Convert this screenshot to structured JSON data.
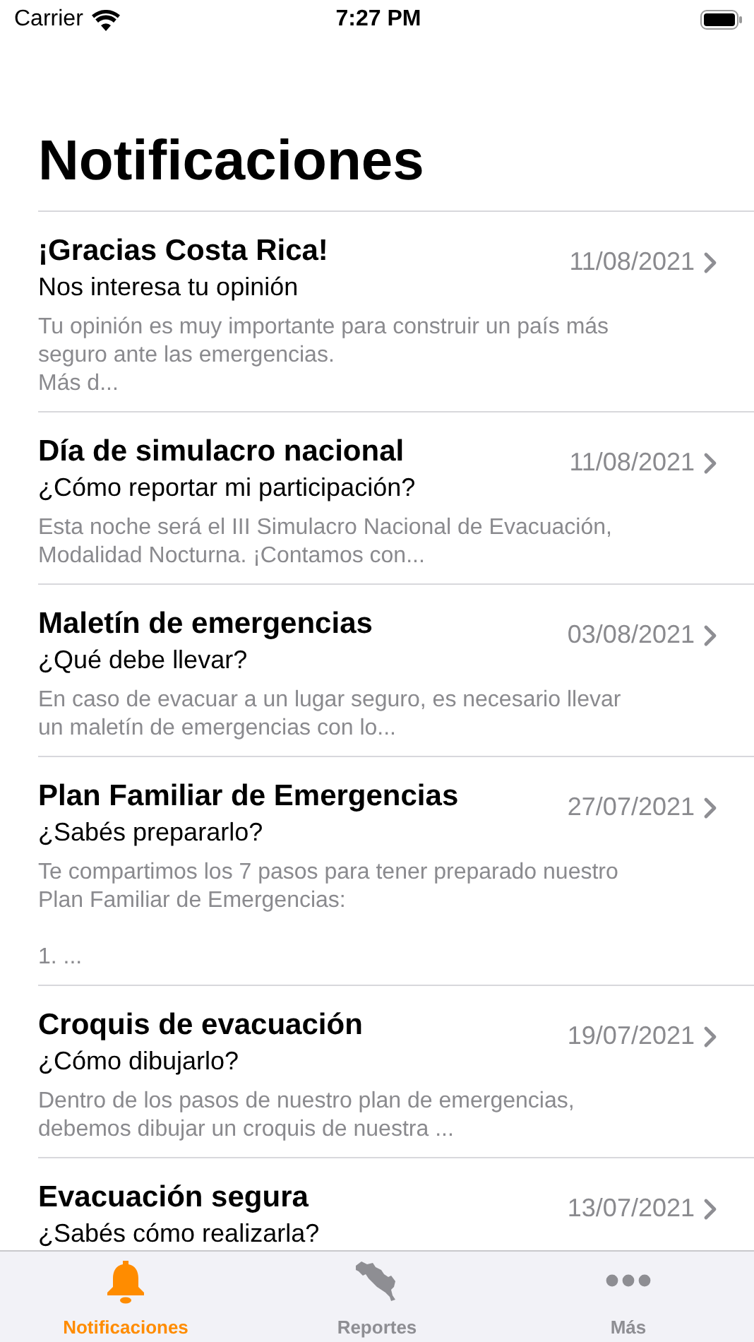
{
  "status_bar": {
    "carrier": "Carrier",
    "time": "7:27 PM"
  },
  "title": "Notificaciones",
  "notifications": [
    {
      "title": "¡Gracias Costa Rica!",
      "subtitle": "Nos interesa tu opinión",
      "date": "11/08/2021",
      "preview": "Tu opinión es muy importante para construir un país más\nseguro ante las emergencias.\nMás d..."
    },
    {
      "title": "Día de simulacro nacional",
      "subtitle": "¿Cómo reportar mi participación?",
      "date": "11/08/2021",
      "preview": "Esta noche será el III Simulacro Nacional de Evacuación,\nModalidad Nocturna. ¡Contamos con..."
    },
    {
      "title": "Maletín de emergencias",
      "subtitle": "¿Qué debe llevar?",
      "date": "03/08/2021",
      "preview": "En caso de evacuar a un lugar seguro, es necesario llevar\nun maletín de emergencias con lo..."
    },
    {
      "title": "Plan Familiar de Emergencias",
      "subtitle": "¿Sabés prepararlo?",
      "date": "27/07/2021",
      "preview": "Te compartimos los 7 pasos para tener preparado nuestro\nPlan Familiar de Emergencias:\n\n1. ..."
    },
    {
      "title": "Croquis de evacuación",
      "subtitle": "¿Cómo dibujarlo?",
      "date": "19/07/2021",
      "preview": "Dentro de los pasos de nuestro plan de emergencias,\ndebemos dibujar un croquis de nuestra ..."
    },
    {
      "title": "Evacuación segura",
      "subtitle": "¿Sabés cómo realizarla?",
      "date": "13/07/2021"
    }
  ],
  "tabs": [
    {
      "kind": "bell",
      "label": "Notificaciones",
      "selected": true
    },
    {
      "kind": "map",
      "label": "Reportes",
      "selected": false
    },
    {
      "kind": "more",
      "label": "Más",
      "selected": false
    }
  ]
}
